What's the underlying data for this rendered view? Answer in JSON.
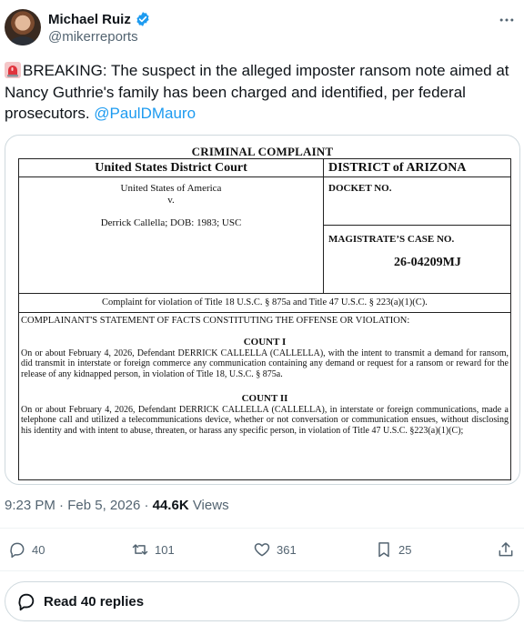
{
  "author": {
    "name": "Michael Ruiz",
    "handle": "@mikerreports"
  },
  "tweet": {
    "text": "BREAKING: The suspect in the alleged imposter ransom note aimed at Nancy Guthrie's family has been charged and identified, per federal prosecutors.",
    "mention": "@PaulDMauro"
  },
  "document": {
    "title": "CRIMINAL COMPLAINT",
    "court": "United States District Court",
    "district": "DISTRICT of ARIZONA",
    "plaintiff": "United States of America",
    "versus": "v.",
    "defendant": "Derrick Callella; DOB: 1983; USC",
    "docket_label": "DOCKET NO.",
    "magistrate_label": "MAGISTRATE’S CASE NO.",
    "case_number": "26-04209MJ",
    "complaint_line": "Complaint for violation of Title 18 U.S.C. § 875a and Title 47 U.S.C. § 223(a)(1)(C).",
    "statement_heading": "COMPLAINANT'S STATEMENT OF FACTS CONSTITUTING THE OFFENSE OR VIOLATION:",
    "count1_title": "COUNT I",
    "count1_text": "On or about February 4, 2026, Defendant DERRICK CALLELLA (CALLELLA), with the intent to transmit a demand for ransom, did transmit in interstate or foreign commerce any communication containing any demand or request for a ransom or reward for the release of any kidnapped person, in violation of Title 18, U.S.C. § 875a.",
    "count2_title": "COUNT II",
    "count2_text": "On or about February 4, 2026, Defendant DERRICK CALLELLA (CALLELLA), in interstate or foreign communications, made a telephone call and utilized a telecommunications device, whether or not conversation or communication ensues, without disclosing his identity and with intent to abuse, threaten, or harass any specific person, in violation of Title 47 U.S.C. §223(a)(1)(C);"
  },
  "meta": {
    "time": "9:23 PM",
    "separator": "·",
    "date": "Feb 5, 2026",
    "views_count": "44.6K",
    "views_label": "Views"
  },
  "actions": {
    "replies": "40",
    "reposts": "101",
    "likes": "361",
    "bookmarks": "25"
  },
  "read_replies_label": "Read 40 replies",
  "icons": {
    "verified": "verified-badge-icon",
    "siren": "siren-emoji-icon",
    "more": "more-dots-icon",
    "reply": "reply-icon",
    "repost": "repost-icon",
    "like": "heart-icon",
    "bookmark": "bookmark-icon",
    "share": "share-icon",
    "bubble": "speech-bubble-icon"
  },
  "colors": {
    "accent": "#1d9bf0",
    "text": "#0f1419",
    "muted": "#536471",
    "border": "#cfd9de"
  }
}
